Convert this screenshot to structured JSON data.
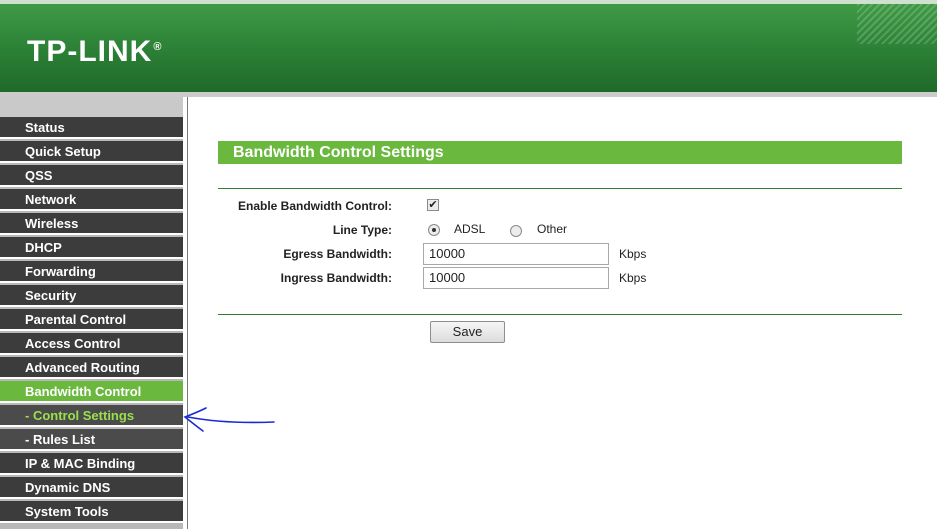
{
  "header": {
    "logo_text": "TP-LINK",
    "logo_mark": "®"
  },
  "sidebar": {
    "items": [
      {
        "label": "Status"
      },
      {
        "label": "Quick Setup"
      },
      {
        "label": "QSS"
      },
      {
        "label": "Network"
      },
      {
        "label": "Wireless"
      },
      {
        "label": "DHCP"
      },
      {
        "label": "Forwarding"
      },
      {
        "label": "Security"
      },
      {
        "label": "Parental Control"
      },
      {
        "label": "Access Control"
      },
      {
        "label": "Advanced Routing"
      },
      {
        "label": "Bandwidth Control",
        "state": "active"
      },
      {
        "label": "- Control Settings",
        "state": "current-sub"
      },
      {
        "label": "- Rules List",
        "state": "sub"
      },
      {
        "label": "IP & MAC Binding"
      },
      {
        "label": "Dynamic DNS"
      },
      {
        "label": "System Tools"
      }
    ]
  },
  "main": {
    "section_title": "Bandwidth Control Settings",
    "enable_label": "Enable Bandwidth Control:",
    "enable_checked": true,
    "line_type_label": "Line Type:",
    "line_type_options": [
      "ADSL",
      "Other"
    ],
    "line_type_selected": "ADSL",
    "egress_label": "Egress Bandwidth:",
    "egress_value": "10000",
    "egress_unit": "Kbps",
    "ingress_label": "Ingress Bandwidth:",
    "ingress_value": "10000",
    "ingress_unit": "Kbps",
    "save_label": "Save"
  },
  "colors": {
    "header_green": "#2e8438",
    "accent_green": "#6bb83e",
    "nav_dark": "#3c3c3c",
    "current_sub_text": "#9be04b",
    "annotation_blue": "#1a2bd6"
  },
  "icons": {
    "checkbox_mark": "✔",
    "annotation": "hand-drawn-arrow-icon"
  }
}
